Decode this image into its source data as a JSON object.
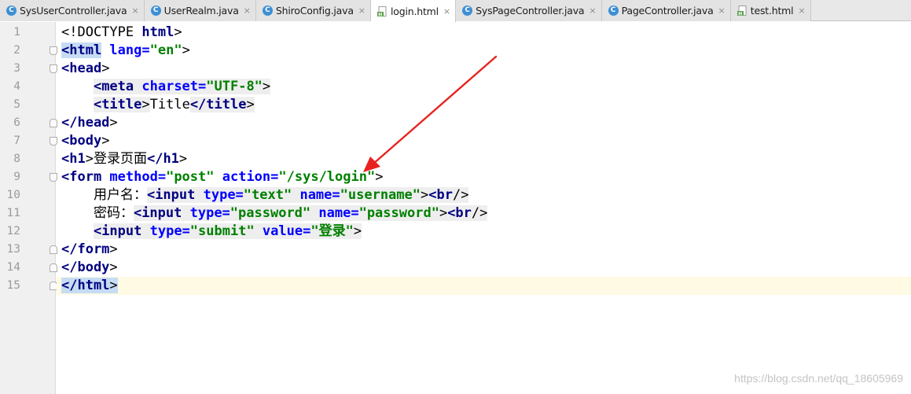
{
  "tabs": [
    {
      "label": "SysUserController.java",
      "type": "java",
      "active": false
    },
    {
      "label": "UserRealm.java",
      "type": "java",
      "active": false
    },
    {
      "label": "ShiroConfig.java",
      "type": "java",
      "active": false
    },
    {
      "label": "login.html",
      "type": "html",
      "active": true
    },
    {
      "label": "SysPageController.java",
      "type": "java",
      "active": false
    },
    {
      "label": "PageController.java",
      "type": "java",
      "active": false
    },
    {
      "label": "test.html",
      "type": "html",
      "active": false
    }
  ],
  "tab_close_glyph": "×",
  "java_icon_glyph": "C",
  "line_numbers": [
    "1",
    "2",
    "3",
    "4",
    "5",
    "6",
    "7",
    "8",
    "9",
    "10",
    "11",
    "12",
    "13",
    "14",
    "15"
  ],
  "current_line": "15",
  "code": {
    "l1": {
      "lt": "<!DOCTYPE ",
      "kw": "html",
      "gt": ">"
    },
    "l2": {
      "open": "<html",
      "attr": " lang=",
      "val": "\"en\"",
      "gt": ">"
    },
    "l3": {
      "open": "<head",
      "gt": ">"
    },
    "l4": {
      "indent": "    ",
      "open": "<meta",
      "attr": " charset=",
      "val": "\"UTF-8\"",
      "gt": ">"
    },
    "l5": {
      "indent": "    ",
      "open": "<title",
      "gt": ">",
      "text": "Title",
      "close": "</title",
      "gt2": ">"
    },
    "l6": {
      "close": "</head",
      "gt": ">"
    },
    "l7": {
      "open": "<body",
      "gt": ">"
    },
    "l8": {
      "open": "<h1",
      "gt": ">",
      "text": "登录页面",
      "close": "</h1",
      "gt2": ">"
    },
    "l9": {
      "open": "<form",
      "attr1": " method=",
      "val1": "\"post\"",
      "attr2": " action=",
      "val2": "\"/sys/login\"",
      "gt": ">"
    },
    "l10": {
      "indent": "    ",
      "text": "用户名：",
      "open": "<input",
      "attr1": " type=",
      "val1": "\"text\"",
      "attr2": " name=",
      "val2": "\"username\"",
      "gt": ">",
      "br": "<br",
      "br_end": "/>"
    },
    "l11": {
      "indent": "    ",
      "text": "密码：",
      "open": "<input",
      "attr1": " type=",
      "val1": "\"password\"",
      "attr2": " name=",
      "val2": "\"password\"",
      "gt": ">",
      "br": "<br",
      "br_end": "/>"
    },
    "l12": {
      "indent": "    ",
      "open": "<input",
      "attr1": " type=",
      "val1": "\"submit\"",
      "attr2": " value=",
      "val2": "\"登录\"",
      "gt": ">"
    },
    "l13": {
      "close": "</form",
      "gt": ">"
    },
    "l14": {
      "close": "</body",
      "gt": ">"
    },
    "l15": {
      "close": "</html",
      "gt": ">"
    }
  },
  "annotation": {
    "color": "#e8231f"
  },
  "watermark": "https://blog.csdn.net/qq_18605969",
  "colors": {
    "tag": "#000080",
    "attribute": "#0000ff",
    "string": "#008000",
    "current_line": "#fffae3",
    "gutter": "#f0f0f0",
    "java_icon": "#3d8fd4"
  }
}
